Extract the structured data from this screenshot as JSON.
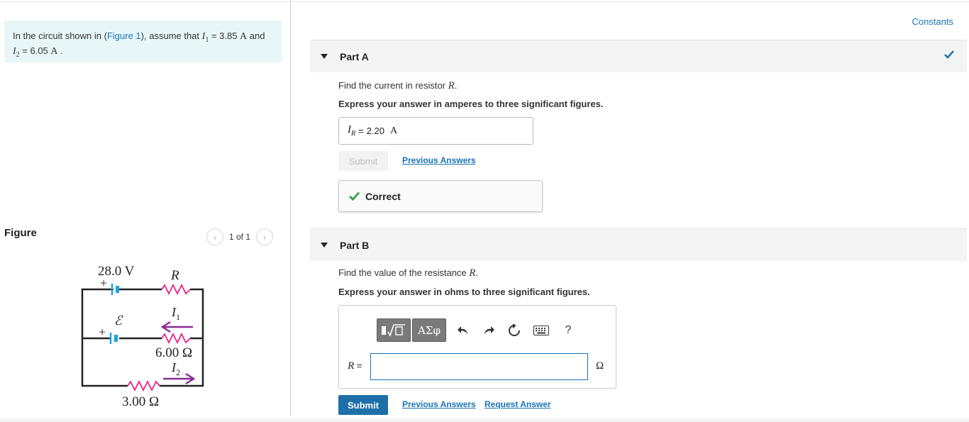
{
  "problem": {
    "intro_pre": "In the circuit shown in (",
    "figure_link": "Figure 1",
    "intro_mid": "), assume that ",
    "i1_sym": "I",
    "i1_sub": "1",
    "i1_val": " = 3.85 ",
    "i1_unit": "A",
    "and": " and",
    "i2_sym": "I",
    "i2_sub": "2",
    "i2_val": " = 6.05 ",
    "i2_unit": "A",
    "end": " ."
  },
  "figure": {
    "title": "Figure",
    "pager_text": "1 of 1",
    "prev_icon": "chevron-left-icon",
    "next_icon": "chevron-right-icon",
    "battery_top": "28.0 V",
    "plus_top": "+",
    "emf_label": "ℰ",
    "plus_mid": "+",
    "resistor_r": "R",
    "current_1": "I",
    "current_1_sub": "1",
    "resistor_mid": "6.00 Ω",
    "current_2": "I",
    "current_2_sub": "2",
    "resistor_bottom": "3.00 Ω",
    "wire_color": "#222222",
    "battery_color": "#1aa3e0",
    "resistor_color": "#e8208c",
    "arrow_color": "#8a2b96"
  },
  "header": {
    "constants_link": "Constants"
  },
  "part_a": {
    "title": "Part A",
    "status_icon": "checkmark-icon",
    "question_pre": "Find the current in resistor ",
    "question_sym": "R",
    "question_post": ".",
    "instruction": "Express your answer in amperes to three significant figures.",
    "answer_label": "I",
    "answer_label_sub": "R",
    "answer_eq": " = ",
    "answer_value": "2.20",
    "answer_unit": "A",
    "submit_label": "Submit",
    "previous_answers": "Previous Answers",
    "feedback": "Correct"
  },
  "part_b": {
    "title": "Part B",
    "question_pre": "Find the value of the resistance ",
    "question_sym": "R",
    "question_post": ".",
    "instruction": "Express your answer in ohms to three significant figures.",
    "toolbar": {
      "templates_icon": "math-templates-icon",
      "symbols_label": "ΑΣφ",
      "undo_icon": "undo-icon",
      "redo_icon": "redo-icon",
      "reset_icon": "reset-icon",
      "keyboard_icon": "keyboard-icon",
      "help_label": "?"
    },
    "input_label": "R",
    "input_eq": " =",
    "input_value": "",
    "unit": "Ω",
    "submit_label": "Submit",
    "previous_answers": "Previous Answers",
    "request_answer": "Request Answer"
  },
  "colors": {
    "accent": "#1a73b8",
    "success": "#2e9e3e",
    "submit_bg": "#1d6fa8",
    "intro_bg": "#e8f6f7"
  }
}
